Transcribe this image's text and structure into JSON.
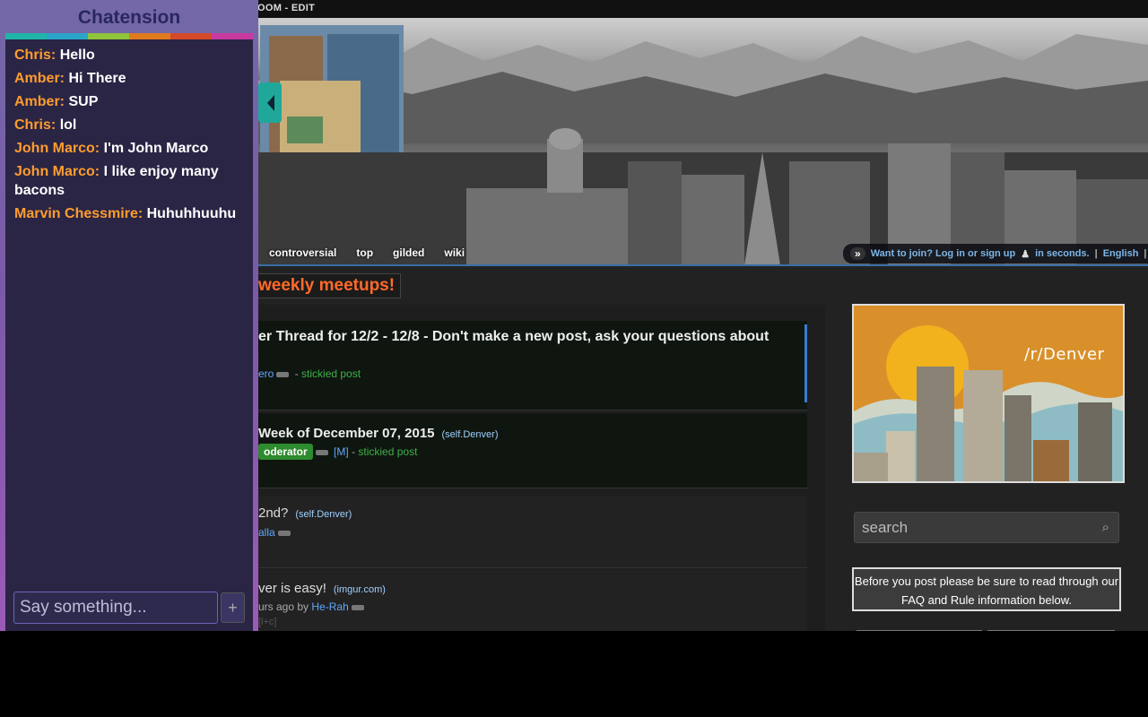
{
  "site": {
    "crumb": "OOM - EDIT",
    "nav_tabs": [
      "controversial",
      "top",
      "gilded",
      "wiki"
    ],
    "userbar": {
      "arrows": "»",
      "join": "Want to join? Log in or sign up",
      "seconds": "in seconds.",
      "sep": "|",
      "lang": "English",
      "lang_sep": "|"
    },
    "meetups": "weekly meetups!",
    "posts": [
      {
        "title": "er Thread for 12/2 - 12/8 - Don't make a new post, ask your questions about",
        "author": "ero",
        "sep": "-",
        "sticky": "stickied post"
      },
      {
        "title": "Week of December 07, 2015",
        "domain": "(self.Denver)",
        "badge": "oderator",
        "mod_tag": "[M]",
        "sep": "-",
        "sticky": "stickied post"
      },
      {
        "title": "2nd?",
        "domain": "(self.Denver)",
        "author": "alla"
      },
      {
        "title": "ver is easy!",
        "domain": "(imgur.com)",
        "byline": "urs ago by",
        "author": "He-Rah",
        "extra": "[l+c]"
      }
    ],
    "sidebar": {
      "logo_text": "/r/Denver",
      "search_placeholder": "search",
      "notice": "Before you post please be sure to read through our FAQ and Rule information below."
    }
  },
  "chat": {
    "title": "Chatension",
    "bar_colors": [
      "#1fb5a8",
      "#2aa5c8",
      "#8fc43a",
      "#e07a1e",
      "#d44a2a",
      "#c83aa0"
    ],
    "messages": [
      {
        "user": "Chris:",
        "text": "Hello"
      },
      {
        "user": "Amber:",
        "text": "Hi There"
      },
      {
        "user": "Amber:",
        "text": "SUP"
      },
      {
        "user": "Chris:",
        "text": "lol"
      },
      {
        "user": "John Marco:",
        "text": "I'm John Marco"
      },
      {
        "user": "John Marco:",
        "text": "I like enjoy many bacons"
      },
      {
        "user": "Marvin Chessmire:",
        "text": "Huhuhhuuhu"
      }
    ],
    "input_placeholder": "Say something...",
    "send_label": "+"
  }
}
